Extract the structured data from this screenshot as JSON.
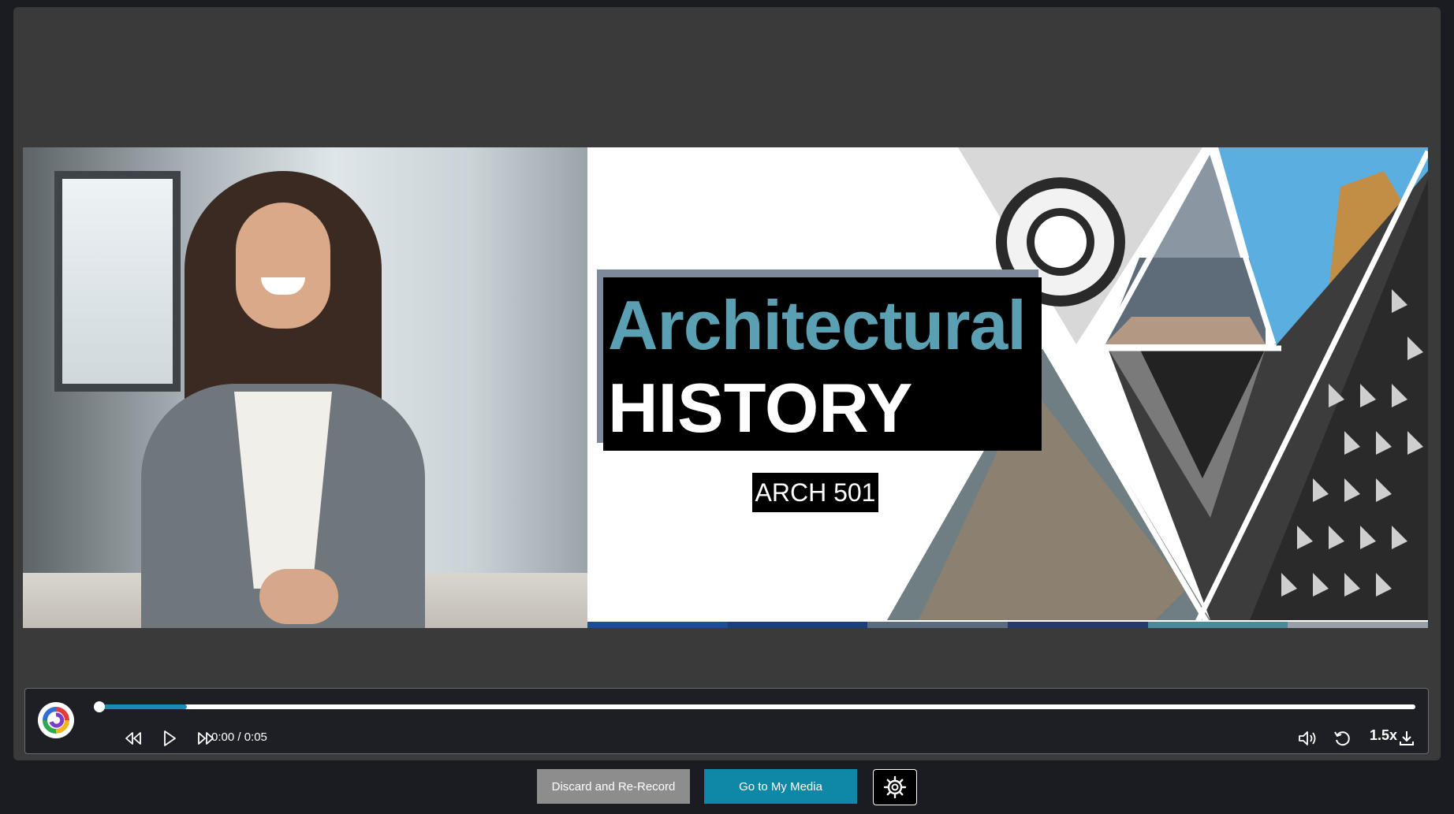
{
  "video": {
    "slide_title_line1": "Architectural",
    "slide_title_line2": "HISTORY",
    "slide_course_code": "ARCH 501",
    "accent_title_color": "#5aa0b2",
    "stripe_colors": [
      "#1f4e8c",
      "#1a3f7a",
      "#5b6b80",
      "#263a6b",
      "#4a8a9a",
      "#9aa0a8"
    ]
  },
  "player": {
    "time_display": "0:00 / 0:05",
    "speed_label": "1.5x",
    "progress_played": 0,
    "progress_buffered": 0.067,
    "accent_color": "#1b8bb0",
    "icons": [
      "rewind-icon",
      "play-icon",
      "fast-forward-icon",
      "volume-icon",
      "replay-icon",
      "download-icon"
    ]
  },
  "actions": {
    "discard_label": "Discard and Re-Record",
    "media_label": "Go to My Media",
    "settings_icon": "gear-icon"
  }
}
